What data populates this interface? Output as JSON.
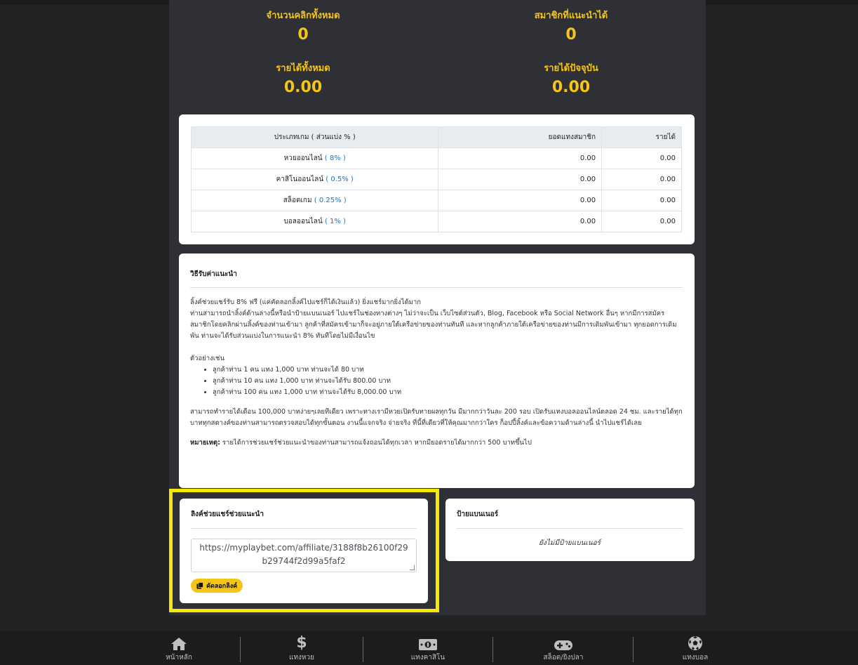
{
  "stats": {
    "total_clicks_label": "จำนวนคลิกทั้งหมด",
    "total_clicks_value": "0",
    "members_label": "สมาชิกที่แนะนำได้",
    "members_value": "0",
    "total_income_label": "รายได้ทั้งหมด",
    "total_income_value": "0.00",
    "current_income_label": "รายได้ปัจจุบัน",
    "current_income_value": "0.00"
  },
  "table": {
    "headers": [
      "ประเภทเกม ( ส่วนแบ่ง % )",
      "ยอดแทงสมาชิก",
      "รายได้"
    ],
    "rows": [
      {
        "name": "หวยออนไลน์",
        "pct": "( 8% )",
        "bet": "0.00",
        "income": "0.00"
      },
      {
        "name": "คาสิโนออนไลน์",
        "pct": "( 0.5% )",
        "bet": "0.00",
        "income": "0.00"
      },
      {
        "name": "สล็อตเกม",
        "pct": "( 0.25% )",
        "bet": "0.00",
        "income": "0.00"
      },
      {
        "name": "บอลออนไลน์",
        "pct": "( 1% )",
        "bet": "0.00",
        "income": "0.00"
      }
    ]
  },
  "info": {
    "title": "วิธีรับค่าแนะนำ",
    "p1": "ลิ้งค์ช่วยแชร์รับ 8% ฟรี (แค่คัดลอกลิ้งค์ไปแชร์ก็ได้เงินแล้ว) ยิ่งแชร์มากยิ่งได้มาก",
    "p2": "ท่านสามารถนำลิ้งค์ด้านล่างนี้หรือนำป้ายแบนเนอร์ ไปแชร์ในช่องทางต่างๆ ไม่ว่าจะเป็น เว็บไซต์ส่วนตัว, Blog, Facebook หรือ Social Network อื่นๆ หากมีการสมัครสมาชิกโดยคลิกผ่านลิ้งค์ของท่านเข้ามา ลูกค้าที่สมัครเข้ามาก็จะอยู่ภายใต้เครือข่ายของท่านทันที และหากลูกค้าภายใต้เครือข่ายของท่านมีการเดิมพันเข้ามา ทุกยอดการเดิมพัน ท่านจะได้รับส่วนแบ่งในการแนะนำ 8% ทันทีโดยไม่มีเงื่อนไข",
    "example_title": "ตัวอย่างเช่น",
    "examples": [
      "ลูกค้าท่าน 1 คน แทง 1,000 บาท ท่านจะได้ 80 บาท",
      "ลูกค้าท่าน 10 คน แทง 1,000 บาท ท่านจะได้รับ 800.00 บาท",
      "ลูกค้าท่าน 100 คน แทง 1,000 บาท ท่านจะได้รับ 8,000.00 บาท"
    ],
    "p3": "สามารถทำรายได้เดือน 100,000 บาทง่ายๆเลยทีเดียว เพราะทางเรามีหวยเปิดรับทายผลทุกวัน มีมากกว่าวันละ 200 รอบ เปิดรับแทงบอลออนไลน์ตลอด 24 ชม. และรายได้ทุกบาททุกสตางค์ของท่านสามารถตรวจสอบได้ทุกขั้นตอน งานนี้แจกจริง จ่ายจริง ที่นี้ที่เดียวที่ให้คุณมากกว่าใคร ก็อปปี้ลิ้งค์และข้อความด้านล่างนี้ นำไปแชร์ได้เลย",
    "note_label": "หมายเหตุ:",
    "note_text": " รายได้การช่วยแชร์ช่วยแนะนำของท่านสามารถแจ้งถอนได้ทุกเวลา หากมียอดรายได้มากกว่า 500 บาทขึ้นไป"
  },
  "share": {
    "title": "ลิงค์ช่วยแชร์ช่วยแนะนำ",
    "url": "https://myplaybet.com/affiliate/3188f8b26100f29b29744f2d99a5faf2",
    "copy_label": "คัดลอกลิงค์"
  },
  "banner": {
    "title": "ป้ายแบนเนอร์",
    "empty_text": "ยังไม่มีป้ายแบนเนอร์"
  },
  "nav": [
    {
      "label": "หน้าหลัก",
      "icon": "home-icon"
    },
    {
      "label": "แทงหวย",
      "icon": "dollar-icon"
    },
    {
      "label": "แทงคาสิโน",
      "icon": "money-bill-icon"
    },
    {
      "label": "สล็อต/ยิงปลา",
      "icon": "gamepad-icon"
    },
    {
      "label": "แทงบอล",
      "icon": "soccer-ball-icon"
    }
  ],
  "colors": {
    "accent": "#f5c518",
    "highlight": "#f7ea00",
    "link": "#1a73c8",
    "background": "#222325",
    "panel": "#2e3035"
  }
}
